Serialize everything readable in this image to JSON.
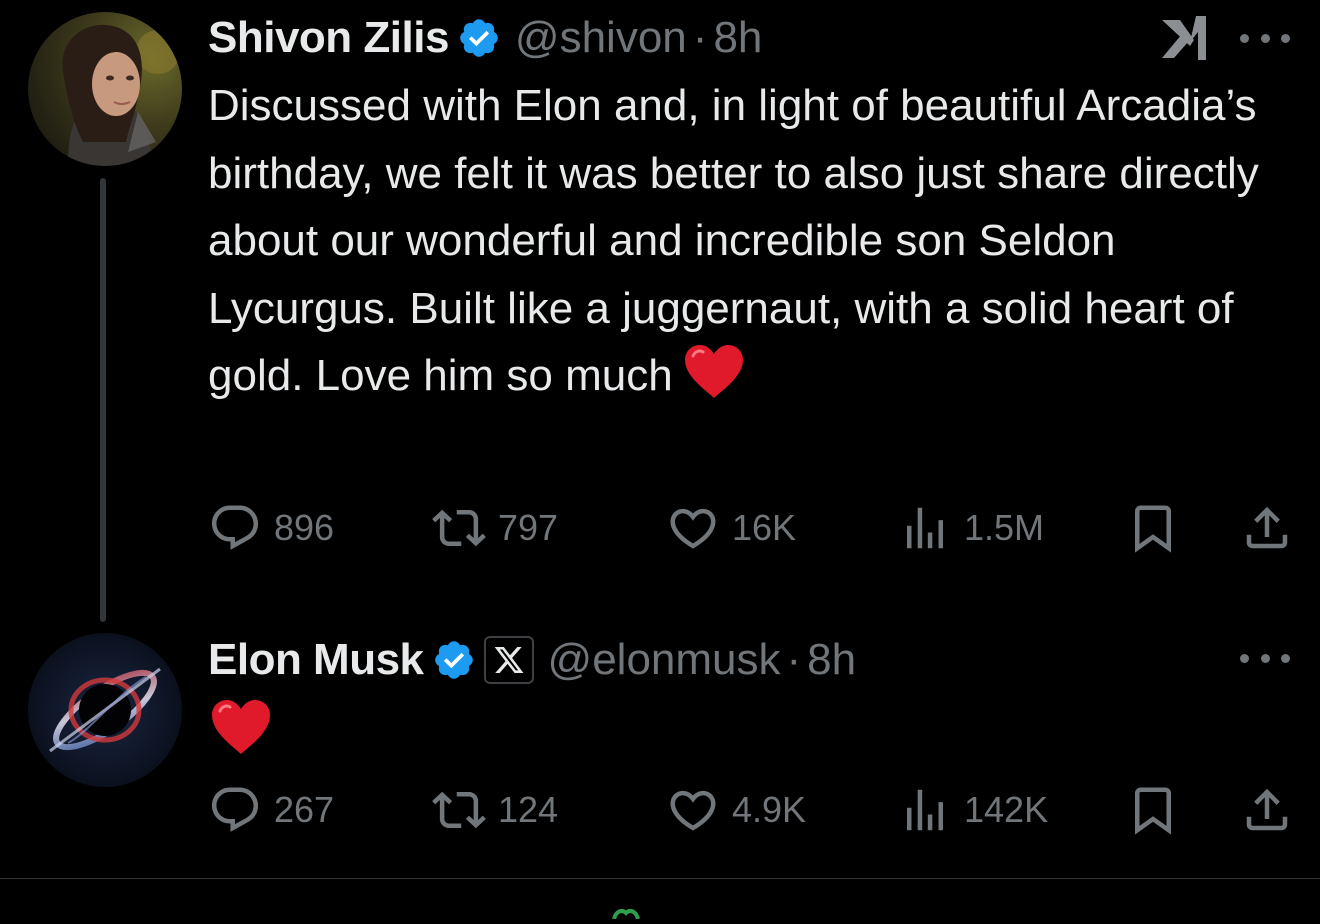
{
  "tweets": [
    {
      "author_name": "Shivon Zilis",
      "verified": true,
      "handle": "@shivon",
      "separator": "·",
      "time": "8h",
      "text": "Discussed with Elon and, in light of beautiful Arcadia’s birthday, we felt it was better to also just share directly about our wonderful and incredible son Seldon Lycurgus. Built like a juggernaut, with a solid heart of gold. Love him so much",
      "emoji": "heart-emoji",
      "stats": {
        "replies": "896",
        "reposts": "797",
        "likes": "16K",
        "views": "1.5M"
      }
    },
    {
      "author_name": "Elon Musk",
      "verified": true,
      "affiliate_badge": "X",
      "handle": "@elonmusk",
      "separator": "·",
      "time": "8h",
      "text": "",
      "emoji": "heart-emoji",
      "stats": {
        "replies": "267",
        "reposts": "124",
        "likes": "4.9K",
        "views": "142K"
      }
    }
  ],
  "colors": {
    "background": "#000000",
    "primary_text": "#e7e9ea",
    "secondary_text": "#71767b",
    "verified_blue": "#1d9bf0",
    "heart_red": "#e0192b",
    "divider": "#2f3336"
  },
  "icons": [
    "grok-icon",
    "more-icon",
    "reply-icon",
    "repost-icon",
    "like-icon",
    "views-icon",
    "bookmark-icon",
    "share-icon",
    "verified-badge-icon",
    "x-logo-icon"
  ]
}
